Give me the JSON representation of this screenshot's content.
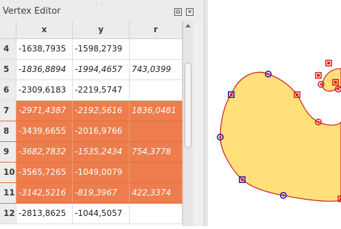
{
  "panel": {
    "title": "Vertex Editor",
    "float_icon": "float-icon",
    "close_icon": "close-icon"
  },
  "table": {
    "columns": [
      "x",
      "y",
      "r"
    ],
    "rows": [
      {
        "index": "4",
        "x": "-1638,7935",
        "y": "-1598,2739",
        "r": "",
        "selected": false,
        "italic": false
      },
      {
        "index": "5",
        "x": "-1836,8894",
        "y": "-1994,4657",
        "r": "743,0399",
        "selected": false,
        "italic": true
      },
      {
        "index": "6",
        "x": "-2309,6183",
        "y": "-2219,5747",
        "r": "",
        "selected": false,
        "italic": false
      },
      {
        "index": "7",
        "x": "-2971,4387",
        "y": "-2192,5616",
        "r": "1836,0481",
        "selected": true,
        "italic": true
      },
      {
        "index": "8",
        "x": "-3439,6655",
        "y": "-2016,9766",
        "r": "",
        "selected": true,
        "italic": false
      },
      {
        "index": "9",
        "x": "-3682,7832",
        "y": "-1535,2434",
        "r": "754,3778",
        "selected": true,
        "italic": true
      },
      {
        "index": "10",
        "x": "-3565,7265",
        "y": "-1049,0079",
        "r": "",
        "selected": true,
        "italic": false
      },
      {
        "index": "11",
        "x": "-3142,5216",
        "y": "-819,3967",
        "r": "422,3374",
        "selected": true,
        "italic": true
      },
      {
        "index": "12",
        "x": "-2813,8625",
        "y": "-1044,5057",
        "r": "",
        "selected": false,
        "italic": false
      }
    ]
  },
  "map": {
    "fill_color": "#ffe07a",
    "stroke_color": "#d42020",
    "vertex_square_color": "#1a1ab0",
    "vertex_circle_color": "#1a1ab0"
  }
}
